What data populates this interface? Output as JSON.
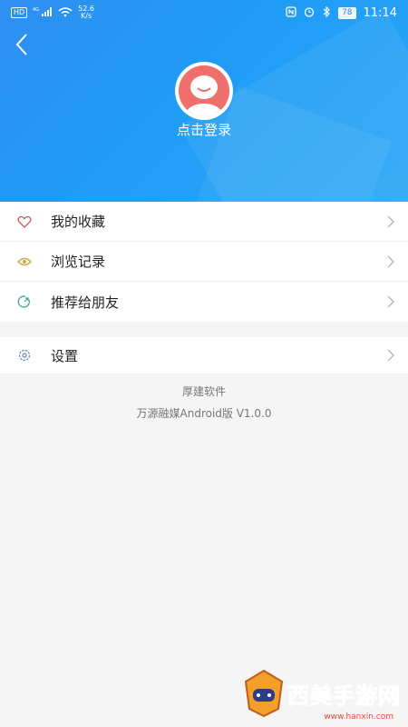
{
  "status_bar": {
    "network_badge": "HD",
    "signal_label": "4G",
    "speed_value": "52.6",
    "speed_unit": "K/s",
    "battery": "78",
    "time": "11:14"
  },
  "header": {
    "login_text": "点击登录"
  },
  "menu": {
    "items": [
      {
        "label": "我的收藏",
        "icon": "heart-icon",
        "color": "#c85a5a"
      },
      {
        "label": "浏览记录",
        "icon": "eye-icon",
        "color": "#c9a93a"
      },
      {
        "label": "推荐给朋友",
        "icon": "share-icon",
        "color": "#4aa38e"
      }
    ]
  },
  "settings": {
    "label": "设置",
    "icon": "gear-icon",
    "color": "#6a8bb5"
  },
  "footer": {
    "company": "厚建软件",
    "version": "万源融媒Android版 V1.0.0"
  },
  "watermark": {
    "text": "西美手游网",
    "url": "www.hanxin.com"
  },
  "colors": {
    "header_gradient_start": "#2f8ff0",
    "header_gradient_end": "#2aa6f7",
    "avatar": "#ef6f6c"
  }
}
